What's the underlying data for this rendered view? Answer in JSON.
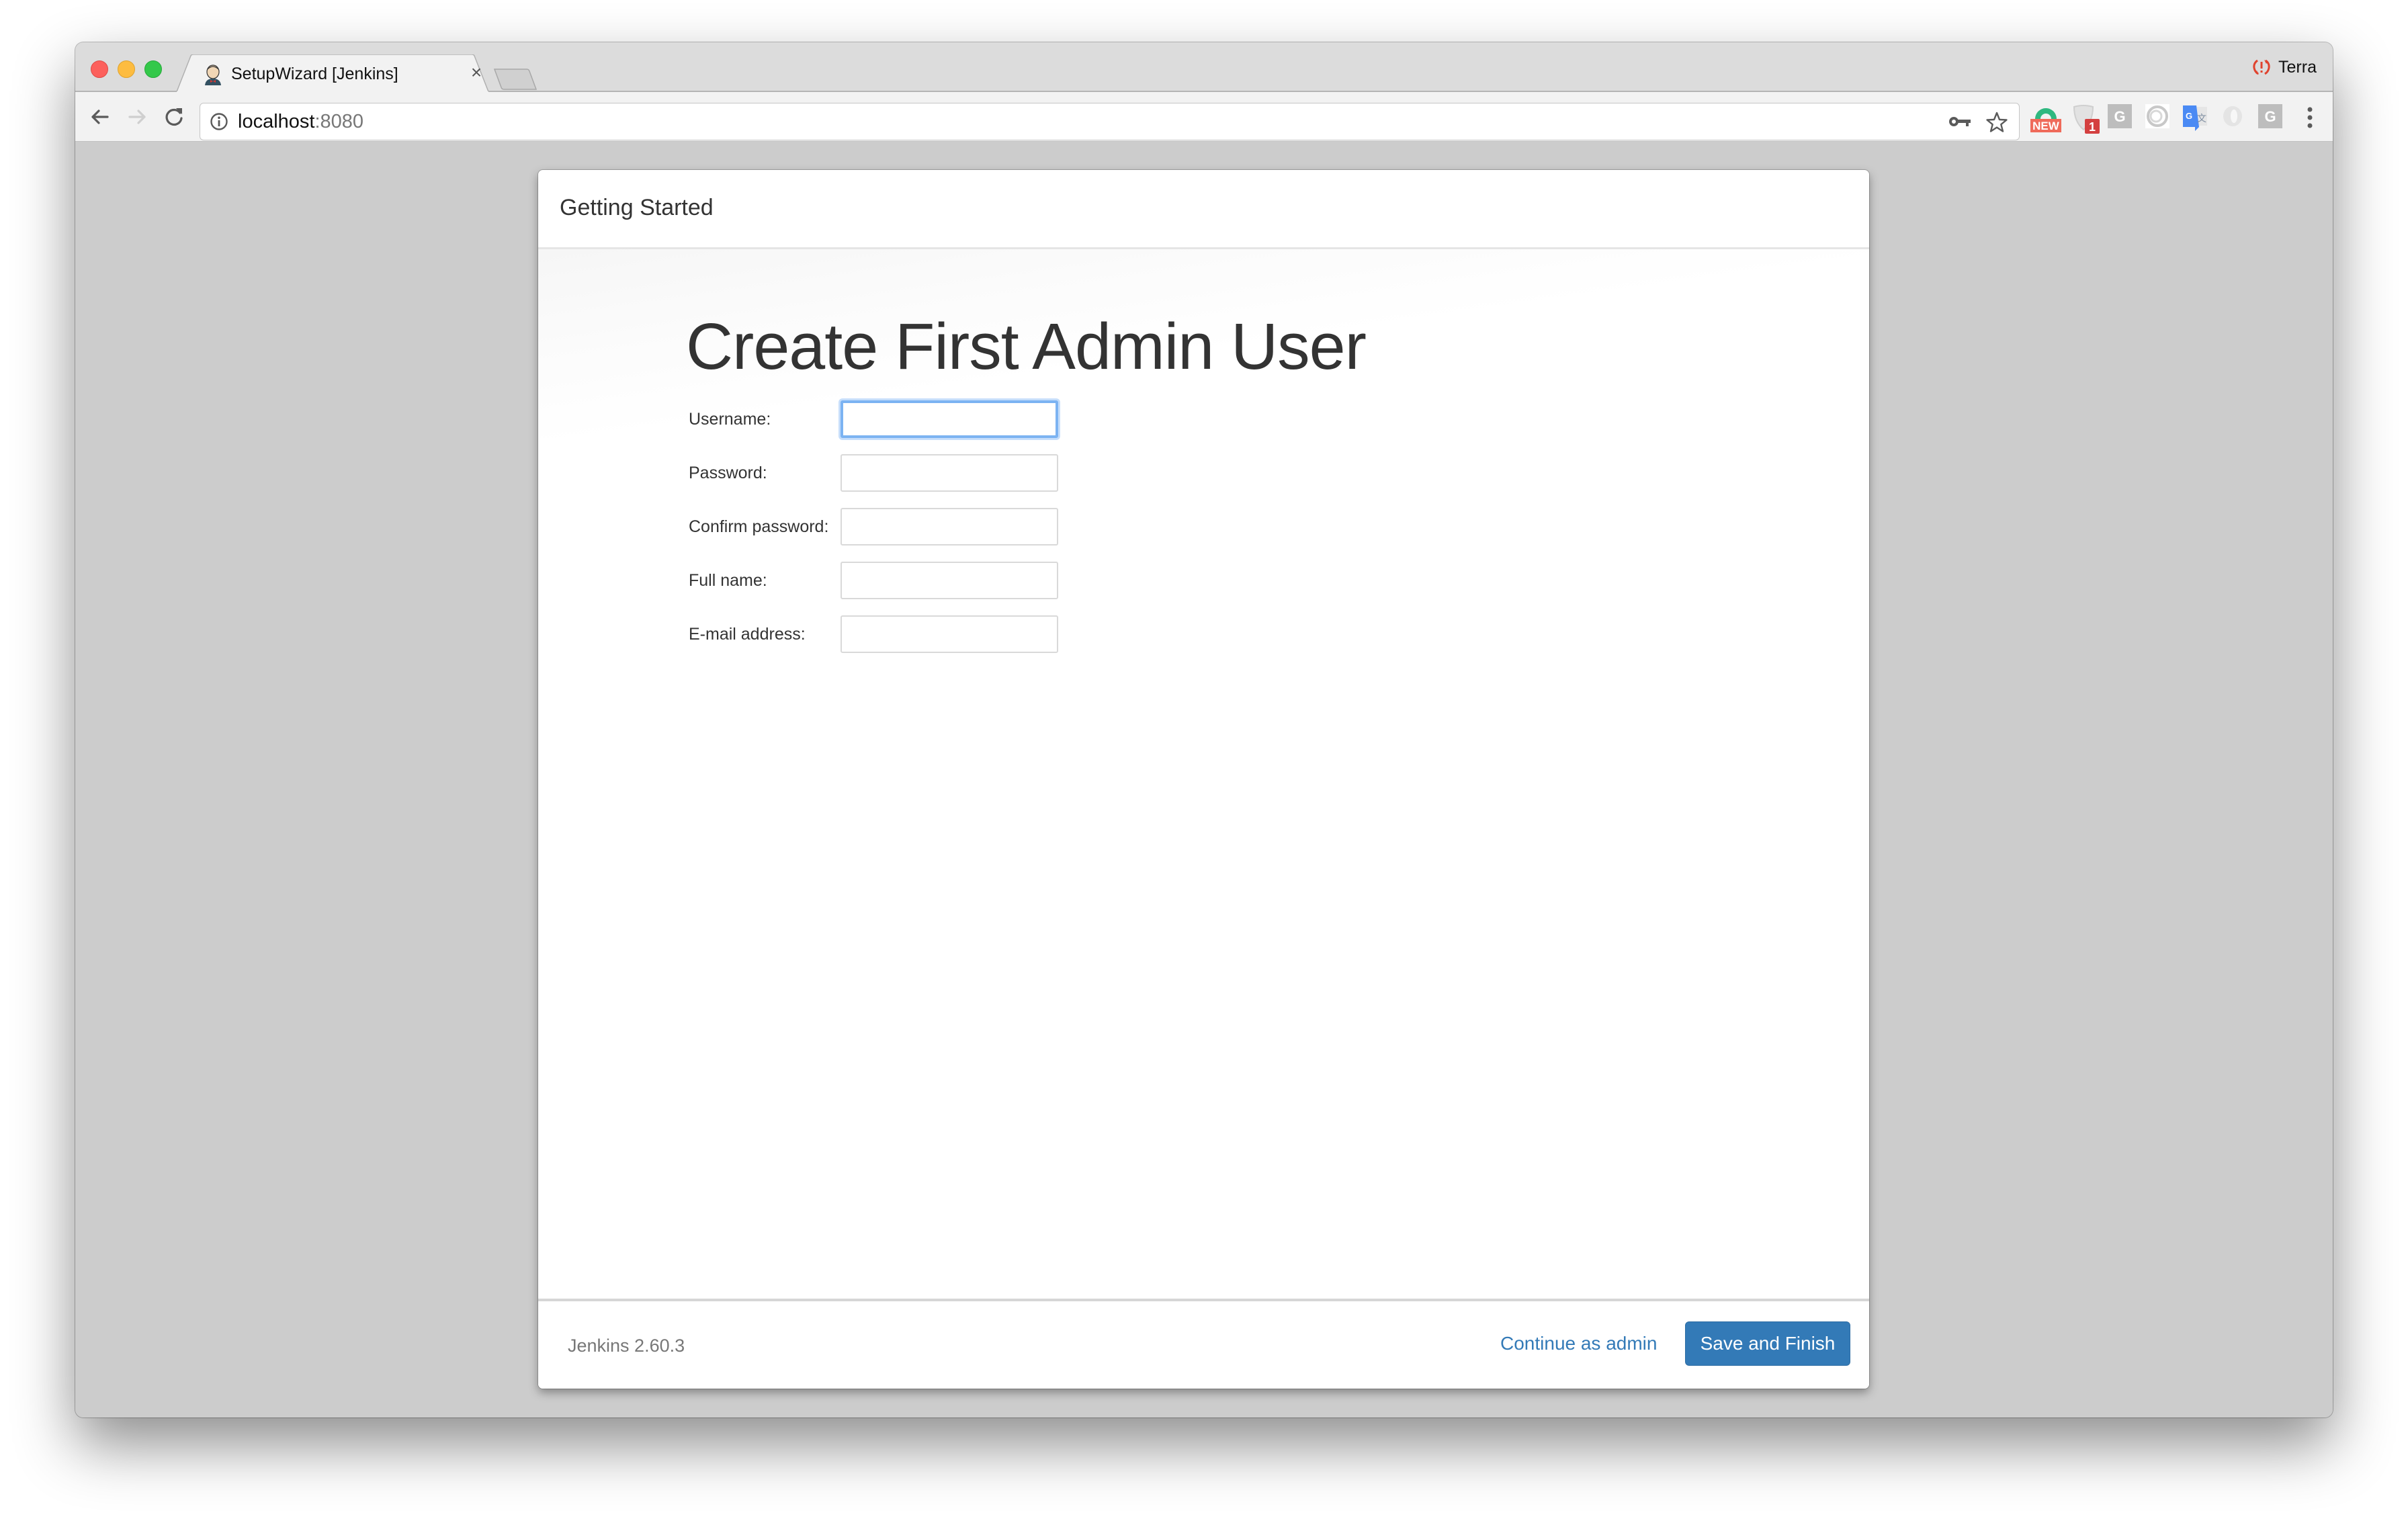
{
  "browser": {
    "tab": {
      "title": "SetupWizard [Jenkins]",
      "favicon": "jenkins-butler-icon",
      "close_glyph": "×"
    },
    "profile": {
      "name": "Terra",
      "icon": "sync-error-icon",
      "icon_glyph": "⟲!"
    },
    "address_bar": {
      "host": "localhost",
      "port": ":8080",
      "info_icon": "info-icon"
    },
    "extensions": [
      {
        "name": "grammarly-new-extension",
        "badge": "NEW",
        "badge_color": "#ef6a5a"
      },
      {
        "name": "shield-extension",
        "badge": "1",
        "badge_color": "#d44040"
      },
      {
        "name": "g-extension-1",
        "badge": ""
      },
      {
        "name": "circle-extension",
        "badge": ""
      },
      {
        "name": "google-translate-extension",
        "badge": ""
      },
      {
        "name": "ring-extension",
        "badge": ""
      },
      {
        "name": "g-extension-2",
        "badge": ""
      }
    ]
  },
  "wizard": {
    "header_title": "Getting Started",
    "page_title": "Create First Admin User",
    "fields": [
      {
        "label": "Username:",
        "value": "",
        "focused": true
      },
      {
        "label": "Password:",
        "value": ""
      },
      {
        "label": "Confirm password:",
        "value": ""
      },
      {
        "label": "Full name:",
        "value": ""
      },
      {
        "label": "E-mail address:",
        "value": ""
      }
    ],
    "footer": {
      "version": "Jenkins 2.60.3",
      "continue_label": "Continue as admin",
      "save_label": "Save and Finish"
    }
  },
  "colors": {
    "primary": "#337ab7",
    "focus_ring": "#7cb3f2",
    "page_bg": "#cccccc"
  }
}
